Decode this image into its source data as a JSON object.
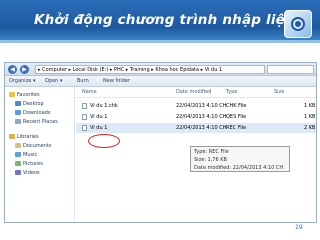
{
  "slide": {
    "title": "Khởi động chương trình nhập liệu",
    "page_number": "19",
    "colors": {
      "title_bg": "#1f5aa0",
      "title_text": "#ffffff",
      "highlight": "#e02020"
    }
  },
  "explorer": {
    "breadcrumb": "▸ Computer ▸ Local Disk (E:) ▸ PHC ▸ Training ▸ Khoa hoc Epidata ▸ Vi du 1",
    "toolbar": {
      "organize": "Organize ▾",
      "open": "Open ▾",
      "burn": "Burn",
      "new_folder": "New folder"
    },
    "nav": {
      "favorites": "Favorites",
      "desktop": "Desktop",
      "downloads": "Downloads",
      "recent_places": "Recent Places",
      "libraries": "Libraries",
      "documents": "Documents",
      "music": "Music",
      "pictures": "Pictures",
      "videos": "Videos"
    },
    "columns": {
      "name": "Name",
      "date": "Date modified",
      "type": "Type",
      "size": "Size"
    },
    "files": [
      {
        "name": "Vi du 1.chk",
        "date": "22/04/2013 4:10 CH",
        "type": "CHK File",
        "size": "1 KB"
      },
      {
        "name": "Vi du 1",
        "date": "22/04/2013 4:10 CH",
        "type": "QES File",
        "size": "1 KB"
      },
      {
        "name": "Vi du 1",
        "date": "22/04/2013 4:10 CH",
        "type": "REC File",
        "size": "2 KB"
      }
    ],
    "tooltip": {
      "type": "Type: REC File",
      "size": "Size: 1,76 KB",
      "date": "Date modified: 22/04/2013 4:10 CH"
    }
  }
}
